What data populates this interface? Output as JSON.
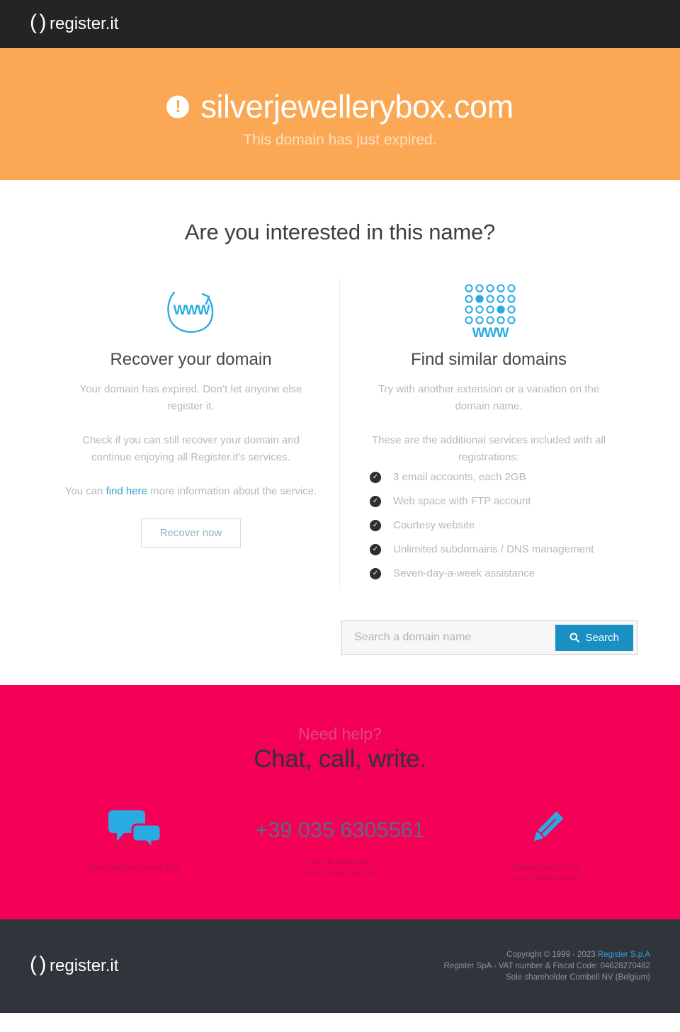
{
  "header": {
    "logo_paren_left": "(",
    "logo_paren_right": ")",
    "logo_text": "register.it"
  },
  "banner": {
    "icon": "exclamation-icon",
    "icon_glyph": "!",
    "domain": "silverjewellerybox.com",
    "subtitle": "This domain has just expired.",
    "background_color": "#fba855"
  },
  "main": {
    "title": "Are you interested in this name?",
    "left": {
      "icon": "www-refresh-icon",
      "icon_label": "WWW",
      "title": "Recover your domain",
      "paragraph_1": "Your domain has expired. Don’t let anyone else register it.",
      "paragraph_2": "Check if you can still recover your domain and continue enjoying all Register.it’s services.",
      "paragraph_3_before": "You can ",
      "paragraph_3_link": "find here",
      "paragraph_3_after": " more information about the service.",
      "button_label": "Recover now"
    },
    "right": {
      "icon": "www-grid-icon",
      "icon_label": "WWW",
      "title": "Find similar domains",
      "paragraph_1": "Try with another extension or a variation on the domain name.",
      "paragraph_2": "These are the additional services included with all registrations:",
      "features": [
        "3 email accounts, each 2GB",
        "Web space with FTP account",
        "Courtesy website",
        "Unlimited subdomains / DNS management",
        "Seven-day-a-week assistance"
      ]
    },
    "search": {
      "placeholder": "Search a domain name",
      "value": "",
      "button_label": "Search",
      "button_icon": "search-icon",
      "button_color": "#1a8fc1"
    }
  },
  "help": {
    "eyebrow": "Need help?",
    "title": "Chat, call, write.",
    "background_color": "#f50057",
    "columns": [
      {
        "icon": "chat-bubbles-icon",
        "caption_line_1": "Chat with us in real time",
        "caption_line_2": ""
      },
      {
        "icon": "phone-number",
        "phone": "+39 035 6305561",
        "caption_line_1": "Call us every day",
        "caption_line_2": "from 9 am to 6 pm"
      },
      {
        "icon": "pencil-icon",
        "caption_line_1": "Request help from",
        "caption_line_2": "your Control Panel"
      }
    ]
  },
  "footer": {
    "logo_paren_left": "(",
    "logo_paren_right": ")",
    "logo_text": "register.it",
    "copyright_prefix": "Copyright © 1999 - 2023 ",
    "copyright_link": "Register S.p.A",
    "vat_line": "Register SpA - VAT number & Fiscal Code: 04628270482",
    "shareholder_line": "Sole shareholder Combell NV (Belgium)"
  }
}
